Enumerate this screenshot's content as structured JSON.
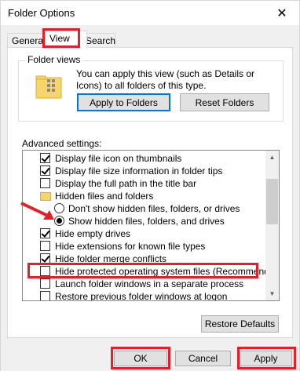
{
  "window": {
    "title": "Folder Options",
    "close_glyph": "✕"
  },
  "tabs": [
    {
      "label": "General",
      "active": false
    },
    {
      "label": "View",
      "active": true
    },
    {
      "label": "Search",
      "active": false
    }
  ],
  "folder_views": {
    "label": "Folder views",
    "description": "You can apply this view (such as Details or Icons) to all folders of this type.",
    "icon": "folder-views-icon",
    "apply_button": "Apply to Folders",
    "reset_button": "Reset Folders"
  },
  "advanced": {
    "label": "Advanced settings:",
    "items": [
      {
        "kind": "checkbox",
        "checked": true,
        "label": "Display file icon on thumbnails"
      },
      {
        "kind": "checkbox",
        "checked": true,
        "label": "Display file size information in folder tips"
      },
      {
        "kind": "checkbox",
        "checked": false,
        "label": "Display the full path in the title bar"
      },
      {
        "kind": "folder",
        "label": "Hidden files and folders"
      },
      {
        "kind": "radio",
        "checked": false,
        "label": "Don't show hidden files, folders, or drives"
      },
      {
        "kind": "radio",
        "checked": true,
        "label": "Show hidden files, folders, and drives"
      },
      {
        "kind": "checkbox",
        "checked": true,
        "label": "Hide empty drives"
      },
      {
        "kind": "checkbox",
        "checked": false,
        "label": "Hide extensions for known file types"
      },
      {
        "kind": "checkbox",
        "checked": true,
        "label": "Hide folder merge conflicts"
      },
      {
        "kind": "checkbox",
        "checked": false,
        "label": "Hide protected operating system files (Recommended)"
      },
      {
        "kind": "checkbox",
        "checked": false,
        "label": "Launch folder windows in a separate process"
      },
      {
        "kind": "checkbox",
        "checked": false,
        "label": "Restore previous folder windows at logon"
      }
    ]
  },
  "restore_defaults": "Restore Defaults",
  "footer": {
    "ok": "OK",
    "cancel": "Cancel",
    "apply": "Apply"
  },
  "colors": {
    "highlight": "#e3202a",
    "accent": "#0078d7"
  }
}
